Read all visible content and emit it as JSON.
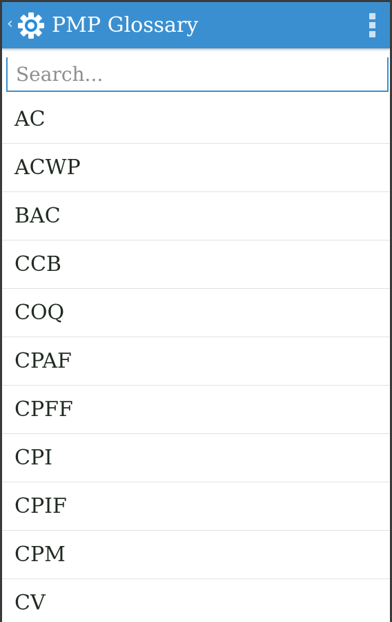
{
  "action_bar": {
    "title": "PMP Glossary",
    "up_glyph": "‹",
    "app_icon": "gear-icon",
    "overflow_icon": "more-vertical-icon",
    "color": "#3a8fd0"
  },
  "search": {
    "placeholder": "Search...",
    "value": ""
  },
  "glossary": {
    "items": [
      {
        "term": "AC"
      },
      {
        "term": "ACWP"
      },
      {
        "term": "BAC"
      },
      {
        "term": "CCB"
      },
      {
        "term": "COQ"
      },
      {
        "term": "CPAF"
      },
      {
        "term": "CPFF"
      },
      {
        "term": "CPI"
      },
      {
        "term": "CPIF"
      },
      {
        "term": "CPM"
      },
      {
        "term": "CV"
      }
    ]
  }
}
